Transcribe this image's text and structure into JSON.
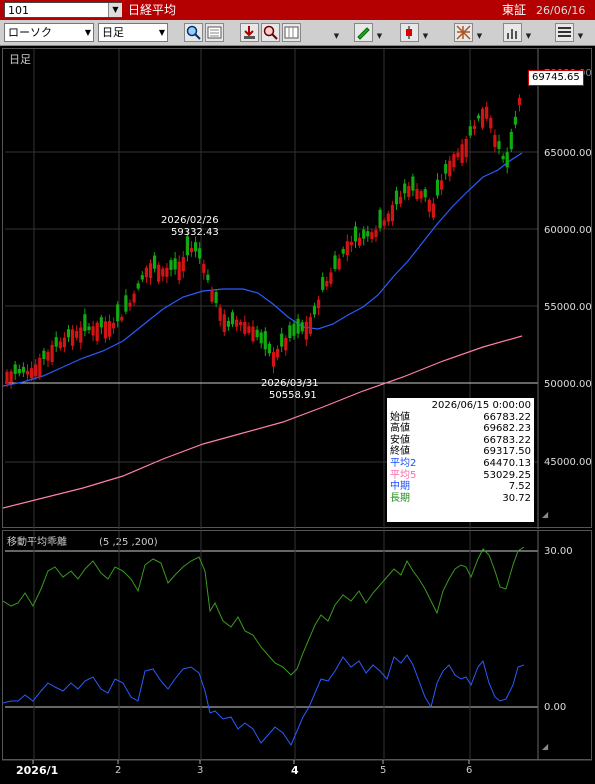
{
  "titlebar": {
    "symbol": "101",
    "title": "日経平均",
    "exchange": "東証",
    "date": "26/06/16"
  },
  "toolbar": {
    "chart_type": "ローソク",
    "period": "日足"
  },
  "main_panel": {
    "label": "日足",
    "current_price": "69745.65",
    "y_ticks": [
      "65000.00",
      "60000.00",
      "55000.00",
      "50000.00",
      "45000.00"
    ],
    "y_partial_top": "70000.00",
    "annotations": [
      {
        "date": "2026/02/26",
        "value": "59332.43"
      },
      {
        "date": "2026/03/31",
        "value": "50558.91"
      }
    ]
  },
  "data_box": {
    "header": "2026/06/15 0:00:00",
    "rows": [
      {
        "label": "始値",
        "value": "66783.22",
        "color": "#000000"
      },
      {
        "label": "高値",
        "value": "69682.23",
        "color": "#000000"
      },
      {
        "label": "安値",
        "value": "66783.22",
        "color": "#000000"
      },
      {
        "label": "終値",
        "value": "69317.50",
        "color": "#000000"
      },
      {
        "label": "平均2",
        "value": "64470.13",
        "color": "#1a4dff"
      },
      {
        "label": "平均5",
        "value": "53029.25",
        "color": "#ff66aa"
      },
      {
        "label": "中期",
        "value": "7.52",
        "color": "#1a4dff"
      },
      {
        "label": "長期",
        "value": "30.72",
        "color": "#1e8c1e"
      }
    ]
  },
  "sub_panel": {
    "label": "移動平均乖離",
    "params": "(5 ,25 ,200)",
    "y_ticks": [
      "30.00",
      "0.00"
    ]
  },
  "x_axis": {
    "labels": [
      "2026/1",
      "2",
      "3",
      "4",
      "5",
      "6"
    ]
  },
  "colors": {
    "up": "#11aa11",
    "down": "#d41414",
    "ma25": "#2a5cff",
    "ma200": "#ff7fa8",
    "title_bg": "#b40000"
  }
}
